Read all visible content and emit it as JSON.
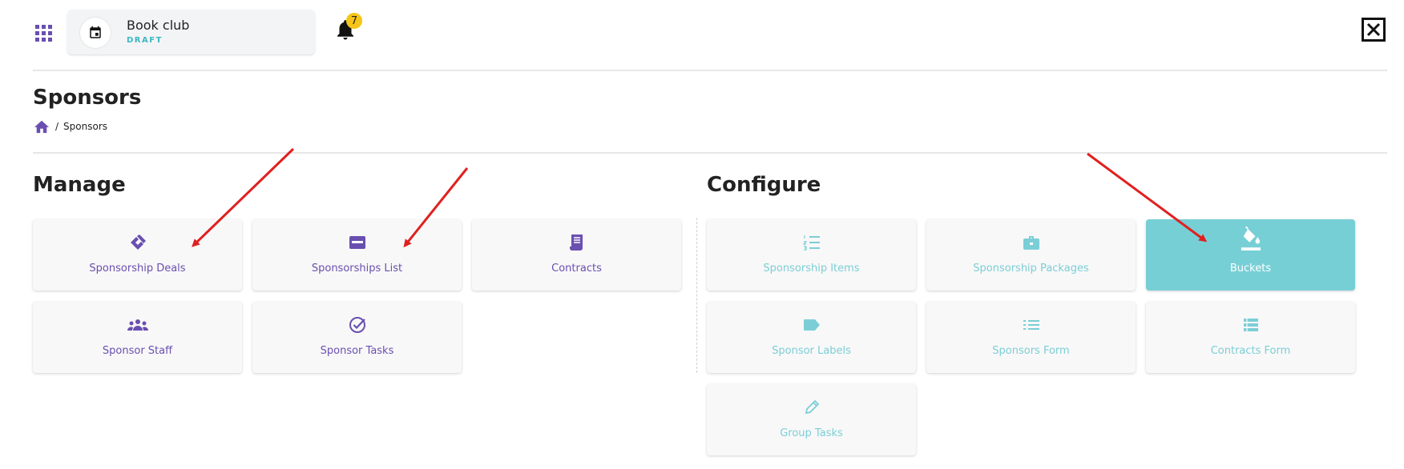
{
  "header": {
    "event_title": "Book club",
    "event_status": "DRAFT",
    "notification_count": "7"
  },
  "page": {
    "title": "Sponsors",
    "breadcrumb_separator": "/",
    "breadcrumb_current": "Sponsors"
  },
  "manage": {
    "title": "Manage",
    "tiles": [
      {
        "label": "Sponsorship Deals",
        "icon": "handshake-icon"
      },
      {
        "label": "Sponsorships List",
        "icon": "card-icon"
      },
      {
        "label": "Contracts",
        "icon": "receipt-icon"
      },
      {
        "label": "Sponsor Staff",
        "icon": "people-icon"
      },
      {
        "label": "Sponsor Tasks",
        "icon": "check-circle-icon"
      }
    ]
  },
  "configure": {
    "title": "Configure",
    "tiles": [
      {
        "label": "Sponsorship Items",
        "icon": "numbered-list-icon"
      },
      {
        "label": "Sponsorship Packages",
        "icon": "briefcase-icon"
      },
      {
        "label": "Buckets",
        "icon": "paint-bucket-icon",
        "active": true
      },
      {
        "label": "Sponsor Labels",
        "icon": "label-tag-icon"
      },
      {
        "label": "Sponsors Form",
        "icon": "list-icon"
      },
      {
        "label": "Contracts Form",
        "icon": "table-list-icon"
      },
      {
        "label": "Group Tasks",
        "icon": "pencil-icon"
      }
    ]
  },
  "colors": {
    "purple": "#6a4fb0",
    "teal": "#7cced6",
    "active_tile": "#77cfd6",
    "annotation_arrow": "#e02020",
    "badge": "#f5c518"
  }
}
